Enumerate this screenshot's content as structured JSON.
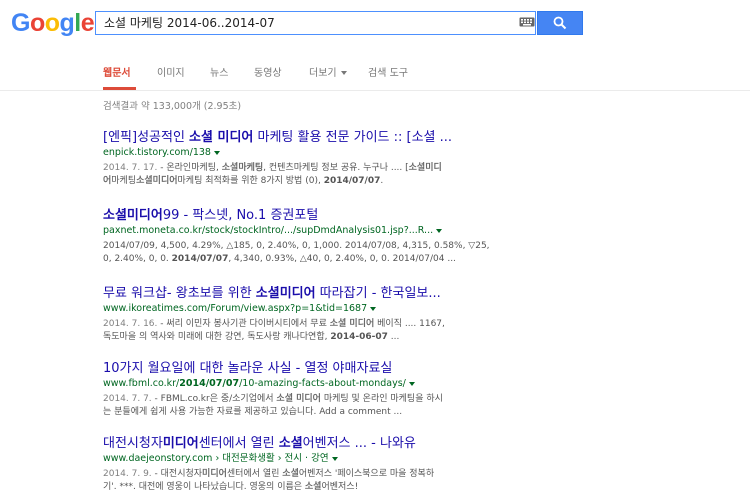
{
  "logo": {
    "letters": [
      "G",
      "o",
      "o",
      "g",
      "l",
      "e"
    ],
    "colors": [
      "#4285f4",
      "#ea4335",
      "#fbbc05",
      "#4285f4",
      "#34a853",
      "#ea4335"
    ]
  },
  "search": {
    "query": "소셜 마케팅 2014-06..2014-07"
  },
  "tabs": [
    {
      "label": "웹문서",
      "active": true
    },
    {
      "label": "이미지"
    },
    {
      "label": "뉴스"
    },
    {
      "label": "동영상"
    },
    {
      "label": "더보기"
    },
    {
      "label": "검색 도구"
    }
  ],
  "result_stats": "검색결과 약 133,000개 (2.95초)",
  "results": [
    {
      "title": {
        "a": "[엔픽]성공적인 ",
        "b": "소셜 미디어",
        "c": " 마케팅 활용 전문 가이드 :: [소셜 ..."
      },
      "url": "enpick.tistory.com/138",
      "s1": {
        "date": "2014. 7. 17.",
        "a": " - 온라인마케팅, ",
        "b": "소셜마케팅",
        "c": ", 컨텐츠마케팅 정보 공유. 누구나 .... [",
        "d": "소셜미디"
      },
      "s2": {
        "a": "어",
        "b": "마케팅",
        "c": "소셜미디어",
        "d": "마케팅 최적화를 위한 8가지 방법 (0), ",
        "e": "2014/07/07",
        "f": "."
      }
    },
    {
      "title": {
        "b": "소셜미디어",
        "c": "99 - 팍스넷, No.1 증권포털"
      },
      "url": "paxnet.moneta.co.kr/stock/stockIntro/.../supDmdAnalysis01.jsp?...R...",
      "s1": {
        "a": "2014/07/09, 4,500, 4.29%, △185, 0, 2.40%, 0, 1,000. 2014/07/08, 4,315, 0.58%, ▽25,"
      },
      "s2": {
        "a": "0, 2.40%, 0, 0. ",
        "b": "2014/07/07",
        "c": ", 4,340, 0.93%, △40, 0, 2.40%, 0, 0. 2014/07/04 ..."
      }
    },
    {
      "title": {
        "a": "무료 워크샵- 왕초보를 위한 ",
        "b": "소셜미디어",
        "c": " 따라잡기 - 한국일보..."
      },
      "url": "www.ikoreatimes.com/Forum/view.aspx?p=1&tid=1687",
      "s1": {
        "date": "2014. 7. 16.",
        "a": " - 써리 이민자 봉사기관 다이버시티에서 무료 ",
        "b": "소셜 미디어",
        "c": " 베이직 .... 1167,"
      },
      "s2": {
        "a": "독도마을 의 역사와 미래에 대한 강연, 독도사랑 캐나다연합, ",
        "b": "2014-06-07",
        "c": " ..."
      }
    },
    {
      "title": {
        "a": "10가지 월요일에 대한 놀라운 사실 - 열정 야매자료실"
      },
      "url": {
        "a": "www.fbml.co.kr/",
        "b": "2014/07/07",
        "c": "/10-amazing-facts-about-mondays/"
      },
      "s1": {
        "date": "2014. 7. 7.",
        "a": " - FBML.co.kr은 중/소기업에서 ",
        "b": "소셜 미디어",
        "c": " 마케팅 및 온라인 마케팅을 하시"
      },
      "s2": {
        "a": "는 분들에게 쉽게 사용 가능한 자료를 제공하고 있습니다. Add a comment ..."
      }
    },
    {
      "title": {
        "a": "대전시청자",
        "b": "미디어",
        "c": "센터에서 열린 ",
        "d": "소셜",
        "e": "어벤저스 ... - 나와유"
      },
      "url": "www.daejeonstory.com › 대전문화생활 › 전시 · 강연",
      "s1": {
        "date": "2014. 7. 9.",
        "a": " - 대전시청자",
        "b": "미디어",
        "c": "센터에서 열린 ",
        "d": "소셜",
        "e": "어벤저스 '페이스북으로 마을 정복하"
      },
      "s2": {
        "a": "기'. ***. 대전에 영웅이 나타났습니다. 영웅의 이름은 ",
        "b": "소셜",
        "c": "어벤저스!"
      }
    }
  ]
}
